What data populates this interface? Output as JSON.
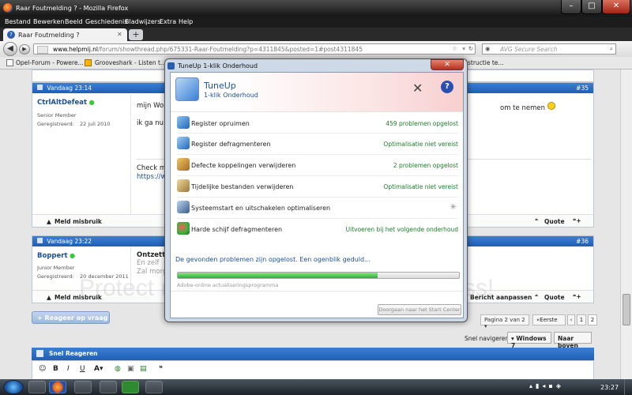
{
  "browser": {
    "window_title": "Raar Foutmelding ? - Mozilla Firefox",
    "menu": [
      "Bestand",
      "Bewerken",
      "Beeld",
      "Geschiedenis",
      "Bladwijzers",
      "Extra",
      "Help"
    ],
    "tab_title": "Raar Foutmelding ?",
    "url_host": "www.helpmij.nl",
    "url_path": "/forum/showthread.php/675331-Raar-Foutmelding?p=4311845&posted=1#post4311845",
    "search_placeholder": "AVG Secure Search",
    "bookmarks": [
      "Opel-Forum - Powere...",
      "Grooveshark - Listen t..."
    ],
    "bookmark_overflow": "structie te..."
  },
  "posts": [
    {
      "date": "Vandaag 23:14",
      "number": "#35",
      "username": "CtrlAltDefeat",
      "rank": "Senior Member",
      "reg_label": "Geregistreerd:",
      "reg_date": "22 juli 2010",
      "text_1": "mijn Wo",
      "text_2": "ik ga nu",
      "text_3": "Check mi",
      "link": "https://w",
      "text_right": "om te nemen",
      "report": "Meld misbruik",
      "quote": "Quote"
    },
    {
      "date": "Vandaag 23:22",
      "number": "#36",
      "username": "Boppert",
      "rank": "Junior Member",
      "reg_label": "Geregistreerd:",
      "reg_date": "20 december 2011",
      "text_1": "Ontzette",
      "text_2": "En zelf",
      "text_3": "Zal morg",
      "report": "Meld misbruik",
      "edit": "Bericht aanpassen",
      "quote": "Quote"
    }
  ],
  "thread": {
    "reply_button": "+ Reageer op vraag",
    "pagination_label": "Pagina 2 van 2",
    "first_label": "Eerste",
    "pages": [
      "1",
      "2"
    ],
    "nav_label": "Snel navigeren",
    "nav_select": "Windows 7",
    "nav_up": "Naar boven",
    "quick_reply_title": "Snel Reageren",
    "watermark": "Protect more of your memories for less!"
  },
  "dialog": {
    "window_title": "TuneUp 1-klik Onderhoud",
    "app_name": "TuneUp",
    "app_subtitle": "1-klik Onderhoud",
    "tasks": [
      {
        "label": "Register opruimen",
        "status": "459 problemen opgelost"
      },
      {
        "label": "Register defragmenteren",
        "status": "Optimalisatie niet vereist"
      },
      {
        "label": "Defecte koppelingen verwijderen",
        "status": "2 problemen opgelost"
      },
      {
        "label": "Tijdelijke bestanden verwijderen",
        "status": "Optimalisatie niet vereist"
      },
      {
        "label": "Systeemstart en uitschakelen optimaliseren",
        "status": ""
      },
      {
        "label": "Harde schijf defragmenteren",
        "status": "Uitvoeren bij het volgende onderhoud"
      }
    ],
    "progress_message": "De gevonden problemen zijn opgelost. Een ogenblik geduld...",
    "progress_sublabel": "Adobe-online actualiseringsprogramma",
    "progress_fraction": 0.71,
    "start_center_button": "Doorgaan naar het Start Center"
  },
  "taskbar": {
    "time": "23:27"
  },
  "colors": {
    "header_blue": "#1f5fb4",
    "status_green": "#1b7e2a",
    "progress_green": "#3cc13c"
  }
}
